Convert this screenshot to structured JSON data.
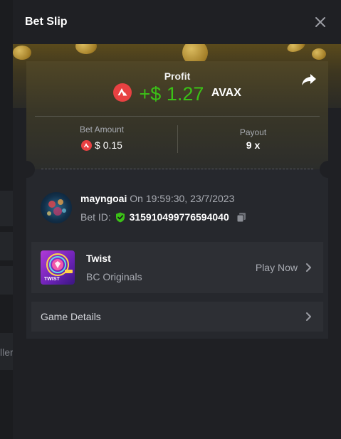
{
  "background": {
    "clipped_text": "ller"
  },
  "modal": {
    "title": "Bet Slip",
    "close_icon": "close-icon"
  },
  "profit": {
    "label": "Profit",
    "value": "+$ 1.27",
    "currency": "AVAX",
    "share_icon": "share-icon",
    "coin_icon": "avax-icon"
  },
  "bet_amount": {
    "label": "Bet Amount",
    "value": "$ 0.15"
  },
  "payout": {
    "label": "Payout",
    "value": "9 x"
  },
  "user": {
    "name": "mayngoai",
    "timestamp": "On 19:59:30, 23/7/2023",
    "bet_id_label": "Bet ID:",
    "bet_id": "315910499776594040",
    "verified_icon": "shield-check-icon",
    "copy_icon": "copy-icon"
  },
  "game": {
    "name": "Twist",
    "provider": "BC Originals",
    "play_label": "Play Now",
    "thumb_text": "TWIST"
  },
  "details": {
    "label": "Game Details"
  },
  "colors": {
    "profit_green": "#3bc117",
    "avax_red": "#e84142",
    "modal_bg": "#1f2024",
    "card_bg": "#26282d",
    "row_bg": "#2d2f34"
  }
}
